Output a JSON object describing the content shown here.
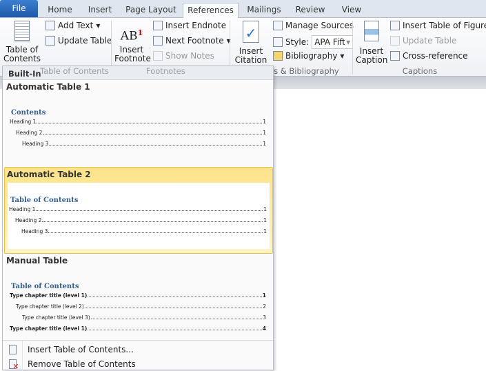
{
  "tabs": [
    "File",
    "Home",
    "Insert",
    "Page Layout",
    "References",
    "Mailings",
    "Review",
    "View"
  ],
  "active_tab": "References",
  "ribbon": {
    "toc": {
      "table_of_contents": "Table of Contents",
      "add_text": "Add Text",
      "update_table": "Update Table",
      "group": "Table of Contents"
    },
    "footnotes": {
      "insert_footnote": "Insert Footnote",
      "insert_endnote": "Insert Endnote",
      "next_footnote": "Next Footnote",
      "show_notes": "Show Notes",
      "group": "Footnotes",
      "footnote_glyph": "AB",
      "footnote_sup": "1"
    },
    "citations": {
      "insert_citation": "Insert Citation",
      "manage_sources": "Manage Sources",
      "style_label": "Style:",
      "style_value": "APA Fifth",
      "bibliography": "Bibliography",
      "group": "Citations & Bibliography"
    },
    "captions": {
      "insert_caption": "Insert Caption",
      "insert_table_of_figures": "Insert Table of Figures",
      "update_table": "Update Table",
      "cross_reference": "Cross-reference",
      "group": "Captions"
    }
  },
  "dropdown": {
    "header": "Built-In",
    "sections": [
      {
        "title": "Automatic Table 1",
        "preview_title": "Contents",
        "rows": [
          {
            "text": "Heading 1",
            "page": "1"
          },
          {
            "text": "Heading 2",
            "page": "1"
          },
          {
            "text": "Heading 3",
            "page": "1"
          }
        ]
      },
      {
        "title": "Automatic Table 2",
        "preview_title": "Table of Contents",
        "rows": [
          {
            "text": "Heading 1",
            "page": "1"
          },
          {
            "text": "Heading 2",
            "page": "1"
          },
          {
            "text": "Heading 3",
            "page": "1"
          }
        ]
      },
      {
        "title": "Manual Table",
        "preview_title": "Table of Contents",
        "rows": [
          {
            "text": "Type chapter title (level 1)",
            "page": "1"
          },
          {
            "text": "Type chapter title (level 2)",
            "page": "2"
          },
          {
            "text": "Type chapter title (level 3)",
            "page": "3"
          },
          {
            "text": "Type chapter title (level 1)",
            "page": "4"
          }
        ]
      }
    ],
    "menu": [
      "Insert Table of Contents...",
      "Remove Table of Contents"
    ]
  },
  "colors": {
    "file_tab": "#2a6cc0",
    "highlight": "#fde38a",
    "toc_title": "#365f91"
  }
}
